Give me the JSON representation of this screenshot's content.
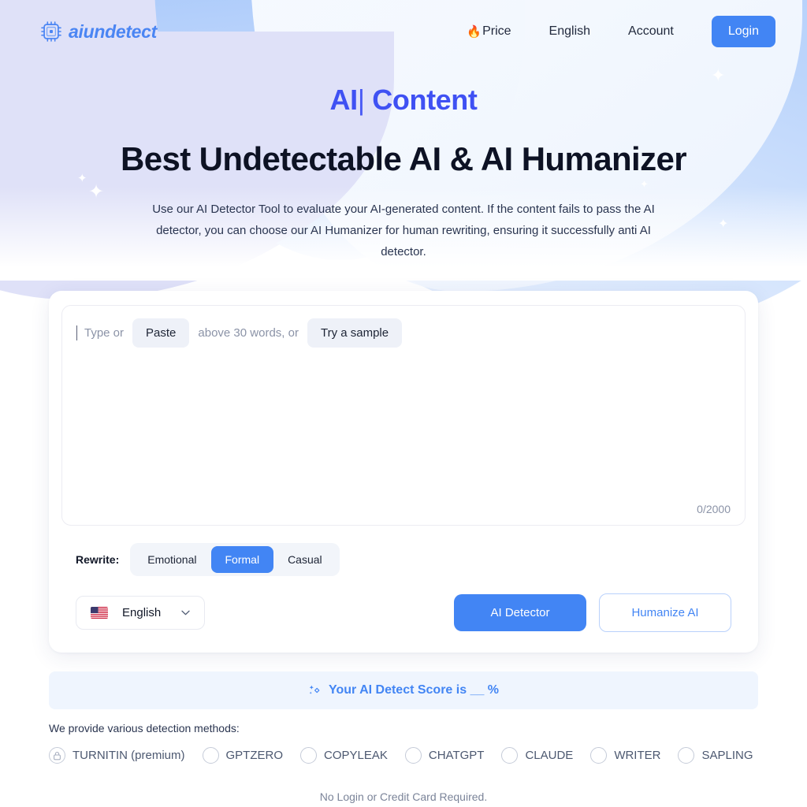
{
  "brand": {
    "name": "aiundetect",
    "icon": "chip-icon",
    "color": "#4a85f3"
  },
  "nav": {
    "items": [
      {
        "label": "Price",
        "icon": "flame-icon"
      },
      {
        "label": "English",
        "icon": null
      },
      {
        "label": "Account",
        "icon": null
      }
    ],
    "login_label": "Login",
    "login_color": "#4285f4"
  },
  "hero": {
    "eyebrow_prefix": "AI",
    "eyebrow_caret": "|",
    "eyebrow_suffix": " Content",
    "eyebrow_color": "#3f51f3",
    "title": "Best Undetectable AI & AI Humanizer",
    "subtitle": "Use our AI Detector Tool to evaluate your AI-generated content. If the content fails to pass the AI detector, you can choose our AI Humanizer for human rewriting, ensuring it successfully anti AI detector."
  },
  "editor": {
    "placeholder_prefix": "Type or",
    "paste_label": "Paste",
    "placeholder_middle": "above 30 words, or",
    "sample_label": "Try a sample",
    "counter": "0/2000",
    "value": ""
  },
  "rewrite": {
    "label": "Rewrite:",
    "options": [
      "Emotional",
      "Formal",
      "Casual"
    ],
    "selected": "Formal",
    "selected_color": "#4285f4"
  },
  "controls": {
    "language": {
      "label": "English",
      "flag": "us-flag-icon",
      "chevron": "chevron-down-icon"
    },
    "detect_button": "AI Detector",
    "humanize_button": "Humanize AI"
  },
  "score_banner": {
    "icon": "sparkle-icon",
    "text": "Your AI Detect Score is __ %",
    "color": "#4285f4",
    "background": "#eff5fe"
  },
  "methods": {
    "label": "We provide various detection methods:",
    "items": [
      {
        "label": "TURNITIN (premium)",
        "locked": true,
        "selected": false
      },
      {
        "label": "GPTZERO",
        "locked": false,
        "selected": false
      },
      {
        "label": "COPYLEAK",
        "locked": false,
        "selected": false
      },
      {
        "label": "CHATGPT",
        "locked": false,
        "selected": false
      },
      {
        "label": "CLAUDE",
        "locked": false,
        "selected": false
      },
      {
        "label": "WRITER",
        "locked": false,
        "selected": false
      },
      {
        "label": "SAPLING",
        "locked": false,
        "selected": false
      }
    ]
  },
  "footnote": "No Login or Credit Card Required."
}
